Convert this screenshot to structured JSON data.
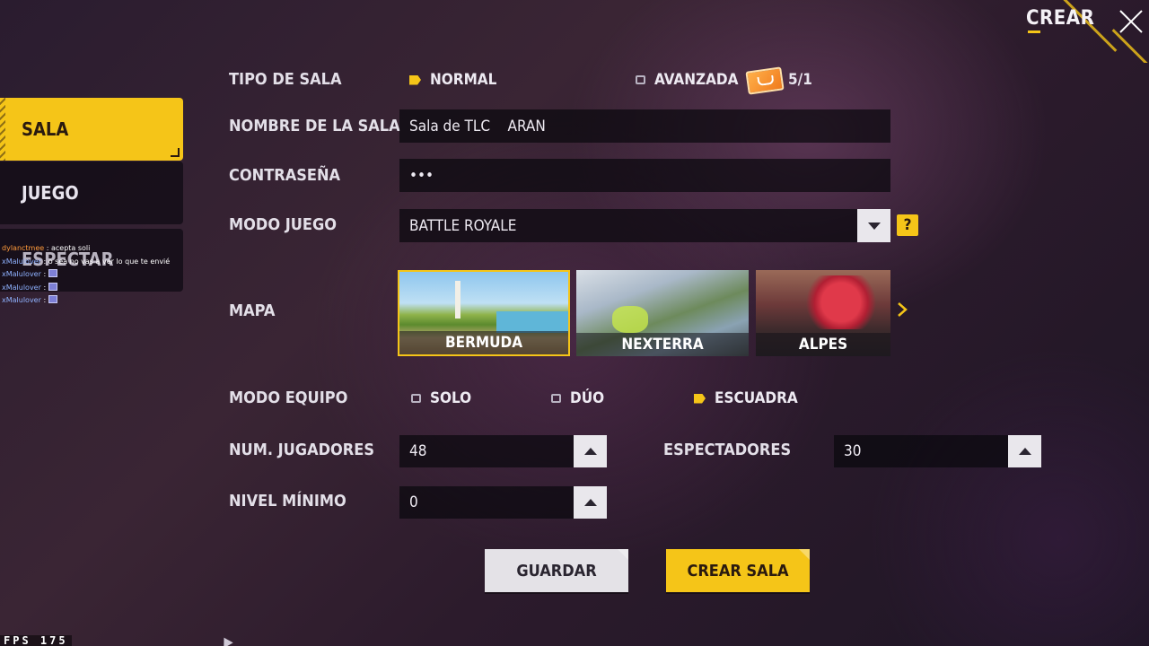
{
  "header": {
    "title": "CREAR",
    "accent": "#f5c518"
  },
  "sidebar": {
    "tabs": [
      {
        "label": "SALA",
        "active": true
      },
      {
        "label": "JUEGO",
        "active": false
      },
      {
        "label": "ESPECTAR",
        "active": false
      }
    ]
  },
  "chat": {
    "lines": [
      {
        "user": "dylanctmee",
        "msg": " : acepta soli"
      },
      {
        "user": "xMalulover",
        "msg": " : o sea no vas a ver lo que te envié"
      },
      {
        "user": "xMalulover",
        "msg": " : "
      },
      {
        "user": "xMalulover",
        "msg": " : "
      },
      {
        "user": "xMalulover",
        "msg": " : "
      }
    ]
  },
  "form": {
    "tipo_sala": {
      "label": "TIPO DE SALA",
      "options": [
        "NORMAL",
        "AVANZADA"
      ],
      "selected": "NORMAL",
      "ticket_count": "5/1"
    },
    "nombre": {
      "label": "NOMBRE DE LA SALA",
      "value": "Sala de TLC    ARAN"
    },
    "password": {
      "label": "CONTRASEÑA",
      "value": "•••"
    },
    "modo_juego": {
      "label": "MODO JUEGO",
      "value": "BATTLE ROYALE",
      "help": "?"
    },
    "mapa": {
      "label": "MAPA",
      "maps": [
        "BERMUDA",
        "NEXTERRA",
        "ALPES"
      ],
      "selected": "BERMUDA"
    },
    "modo_equipo": {
      "label": "MODO EQUIPO",
      "options": [
        "SOLO",
        "DÚO",
        "ESCUADRA"
      ],
      "selected": "ESCUADRA"
    },
    "jugadores": {
      "label": "NUM. JUGADORES",
      "value": "48"
    },
    "espectadores": {
      "label": "ESPECTADORES",
      "value": "30"
    },
    "nivel": {
      "label": "NIVEL MÍNIMO",
      "value": "0"
    }
  },
  "actions": {
    "save_label": "GUARDAR",
    "create_label": "CREAR SALA"
  },
  "fps": "FPS 175"
}
